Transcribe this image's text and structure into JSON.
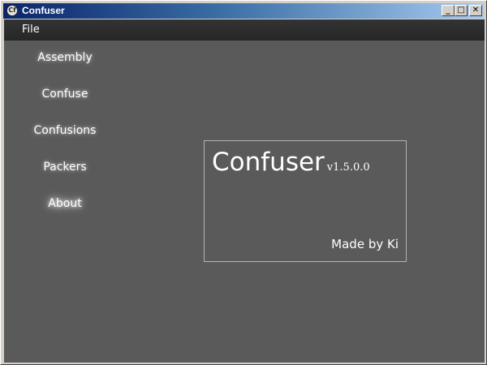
{
  "window": {
    "title": "Confuser",
    "icon": "confuser-app-icon",
    "icon_glyph": "Cf",
    "controls": {
      "minimize": "_",
      "maximize": "□",
      "close": "✕"
    }
  },
  "menu": {
    "file_label": "File"
  },
  "nav": {
    "items": [
      {
        "label": "Assembly",
        "active": false
      },
      {
        "label": "Confuse",
        "active": false
      },
      {
        "label": "Confusions",
        "active": false
      },
      {
        "label": "Packers",
        "active": false
      },
      {
        "label": "About",
        "active": true
      }
    ]
  },
  "about": {
    "product_name": "Confuser",
    "version": "v1.5.0.0",
    "author": "Made by Ki"
  },
  "colors": {
    "client_background": "#5a5a5a",
    "menubar_background": "#2b2b2b",
    "text": "#ffffff",
    "panel_border": "#b4b4b4"
  }
}
